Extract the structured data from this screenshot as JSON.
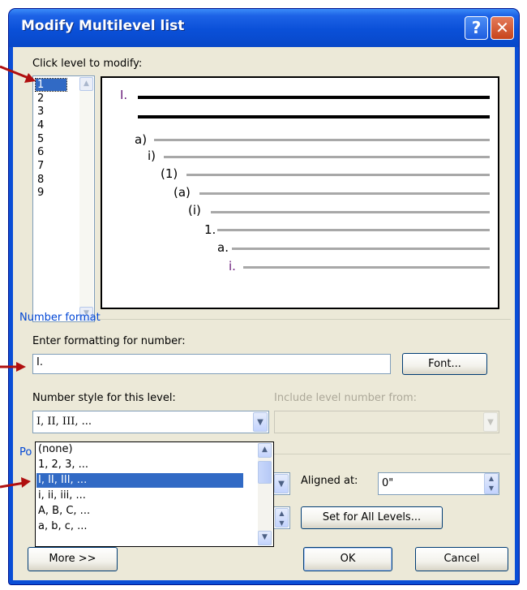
{
  "window": {
    "title": "Modify Multilevel list"
  },
  "title_buttons": {
    "help": "?",
    "close": "✕"
  },
  "levels": {
    "label": "Click level to modify:",
    "items": [
      "1",
      "2",
      "3",
      "4",
      "5",
      "6",
      "7",
      "8",
      "9"
    ],
    "selected": "1"
  },
  "preview": {
    "numbers": [
      "I.",
      "a)",
      "i)",
      "(1)",
      "(a)",
      "(i)",
      "1.",
      "a.",
      "i."
    ]
  },
  "number_format": {
    "group_title": "Number format",
    "enter_label": "Enter formatting for number:",
    "format_value": "I.",
    "font_button": "Font...",
    "style_label": "Number style for this level:",
    "style_value": "I, II, III, ...",
    "include_label": "Include level number from:",
    "include_value": ""
  },
  "position": {
    "group_title_partial": "Po",
    "aligned_label": "Aligned at:",
    "aligned_value": "0\"",
    "set_all_button": "Set for All Levels..."
  },
  "style_dropdown": {
    "options": [
      "(none)",
      "1, 2, 3, ...",
      "I, II, III, ...",
      "i, ii, iii, ...",
      "A, B, C, ...",
      "a, b, c, ..."
    ],
    "selected": "I, II, III, ..."
  },
  "footer": {
    "more_button": "More >>",
    "ok_button": "OK",
    "cancel_button": "Cancel"
  },
  "colors": {
    "title_blue": "#0a4ed6",
    "dialog_bg": "#ece9d8",
    "selection": "#316ac5",
    "annotation_arrow": "#b00f0f",
    "group_title": "#0046d5"
  }
}
